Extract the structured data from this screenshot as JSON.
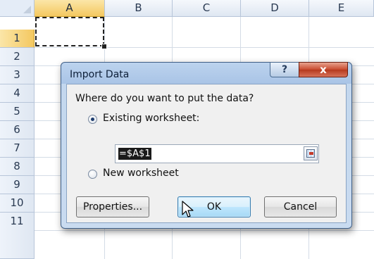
{
  "spreadsheet": {
    "columns": [
      "A",
      "B",
      "C",
      "D",
      "E"
    ],
    "rows": [
      "1",
      "2",
      "3",
      "4",
      "5",
      "6",
      "7",
      "8",
      "9",
      "10",
      "11"
    ],
    "selected_column": "A",
    "selected_row": "1"
  },
  "dialog": {
    "title": "Import Data",
    "help_label": "?",
    "close_label": "x",
    "question": "Where do you want to put the data?",
    "option_existing": "Existing worksheet:",
    "option_existing_selected": true,
    "reference_value": "=$A$1",
    "option_new": "New worksheet",
    "option_new_selected": false,
    "properties_label": "Properties...",
    "ok_label": "OK",
    "cancel_label": "Cancel"
  },
  "icons": [
    "help-icon",
    "close-icon",
    "collapse-dialog-icon",
    "mouse-pointer-icon"
  ]
}
